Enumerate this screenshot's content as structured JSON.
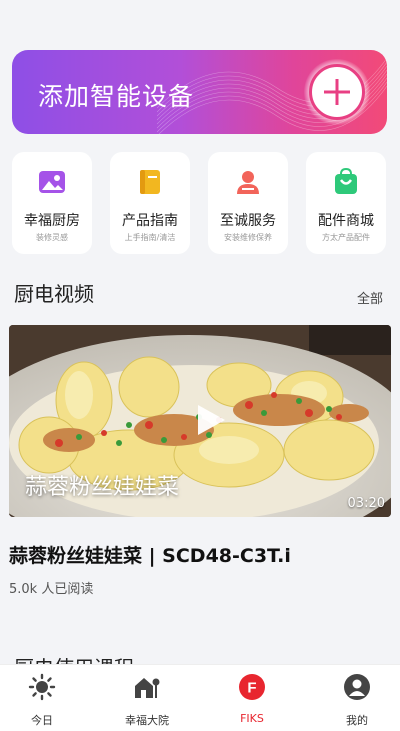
{
  "banner": {
    "title": "添加智能设备",
    "add_icon": "plus-circle-icon"
  },
  "cards": [
    {
      "title": "幸福厨房",
      "sub": "装修灵感",
      "icon": "image-icon",
      "color": "#a553e8"
    },
    {
      "title": "产品指南",
      "sub": "上手指南/清洁",
      "icon": "book-icon",
      "color": "#f2b720"
    },
    {
      "title": "至诚服务",
      "sub": "安装维修保养",
      "icon": "user-icon",
      "color": "#f2645a"
    },
    {
      "title": "配件商城",
      "sub": "方太产品配件",
      "icon": "shopping-bag-icon",
      "color": "#2ec97a"
    }
  ],
  "section": {
    "title": "厨电视频",
    "more": "全部"
  },
  "video": {
    "overlay_caption": "蒜蓉粉丝娃娃菜",
    "duration": "03:20",
    "title": "蒜蓉粉丝娃娃菜 | SCD48-C3T.i",
    "views": "5.0k 人已阅读"
  },
  "section2": {
    "title": "厨电使用课程"
  },
  "tabs": [
    {
      "label": "今日",
      "icon": "sun-icon"
    },
    {
      "label": "幸福大院",
      "icon": "house-icon"
    },
    {
      "label": "FIKS",
      "icon": "fiks-logo-icon",
      "active": true
    },
    {
      "label": "我的",
      "icon": "profile-icon"
    }
  ],
  "colors": {
    "accent": "#e8262f",
    "banner_start": "#8e4fe6",
    "banner_end": "#f24a78"
  }
}
